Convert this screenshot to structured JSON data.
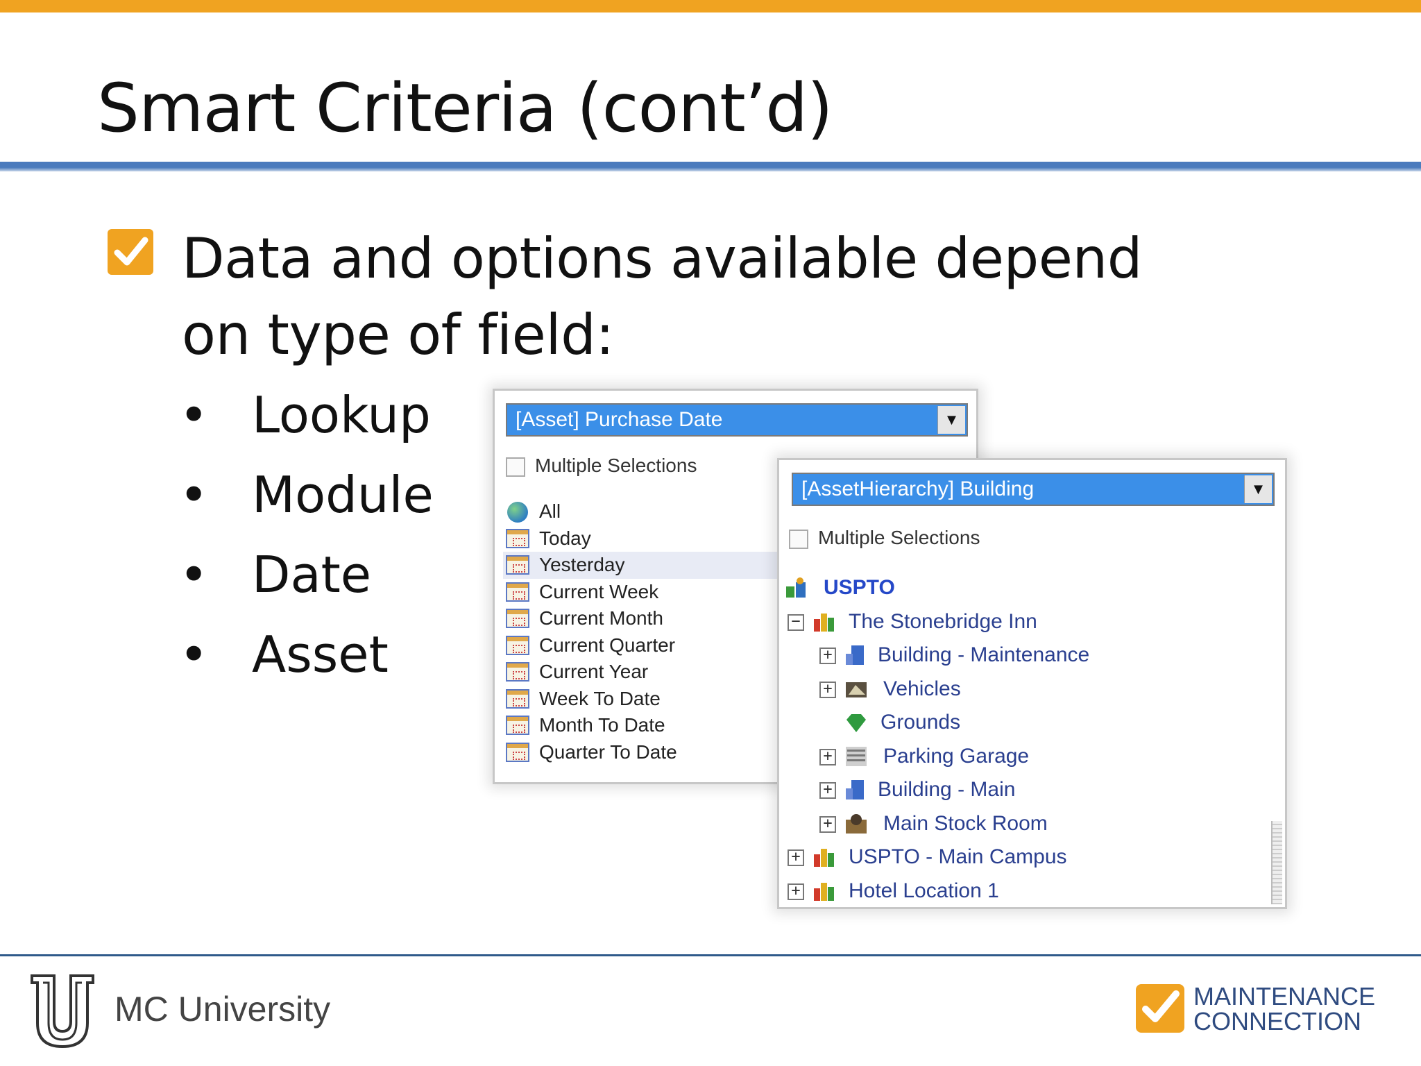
{
  "slide": {
    "title": "Smart Criteria (cont’d)",
    "main_bullet": "Data and options available depend on type of field:",
    "sub_bullet_glyph": "•",
    "sub_bullets": [
      "Lookup",
      "Module",
      "Date",
      "Asset"
    ]
  },
  "date_window": {
    "select_value": "[Asset] Purchase Date",
    "multiple_selections_label": "Multiple Selections",
    "items": [
      {
        "label": "All",
        "icon": "globe-icon"
      },
      {
        "label": "Today",
        "icon": "calendar-icon"
      },
      {
        "label": "Yesterday",
        "icon": "calendar-icon",
        "highlighted": true
      },
      {
        "label": "Current Week",
        "icon": "calendar-icon"
      },
      {
        "label": "Current Month",
        "icon": "calendar-icon"
      },
      {
        "label": "Current Quarter",
        "icon": "calendar-icon"
      },
      {
        "label": "Current Year",
        "icon": "calendar-icon"
      },
      {
        "label": "Week To Date",
        "icon": "calendar-icon"
      },
      {
        "label": "Month To Date",
        "icon": "calendar-icon"
      },
      {
        "label": "Quarter To Date",
        "icon": "calendar-icon"
      }
    ]
  },
  "asset_window": {
    "select_value": "[AssetHierarchy] Building",
    "multiple_selections_label": "Multiple Selections",
    "tree": [
      {
        "label": "USPTO",
        "icon": "org-root-icon",
        "level": 0,
        "expander": "none"
      },
      {
        "label": "The Stonebridge Inn",
        "icon": "campus-icon",
        "level": 0,
        "expander": "collapse"
      },
      {
        "label": "Building - Maintenance",
        "icon": "building-icon",
        "level": 1,
        "expander": "expand"
      },
      {
        "label": "Vehicles",
        "icon": "vehicle-icon",
        "level": 1,
        "expander": "expand"
      },
      {
        "label": "Grounds",
        "icon": "grounds-icon",
        "level": 1,
        "expander": "none"
      },
      {
        "label": "Parking Garage",
        "icon": "garage-icon",
        "level": 1,
        "expander": "expand"
      },
      {
        "label": "Building - Main",
        "icon": "building-icon",
        "level": 1,
        "expander": "expand"
      },
      {
        "label": "Main Stock Room",
        "icon": "stockroom-icon",
        "level": 1,
        "expander": "expand"
      },
      {
        "label": "USPTO - Main Campus",
        "icon": "campus-icon",
        "level": 0,
        "expander": "expand"
      },
      {
        "label": "Hotel Location 1",
        "icon": "campus-icon",
        "level": 0,
        "expander": "expand"
      }
    ]
  },
  "footer": {
    "left_text": "MC University",
    "logo_line1": "MAINTENANCE",
    "logo_line2": "CONNECTION"
  },
  "colors": {
    "accent_orange": "#f0a321",
    "rule_blue": "#4b7bbd",
    "select_blue": "#3b8fe8",
    "footer_text": "#444444"
  }
}
